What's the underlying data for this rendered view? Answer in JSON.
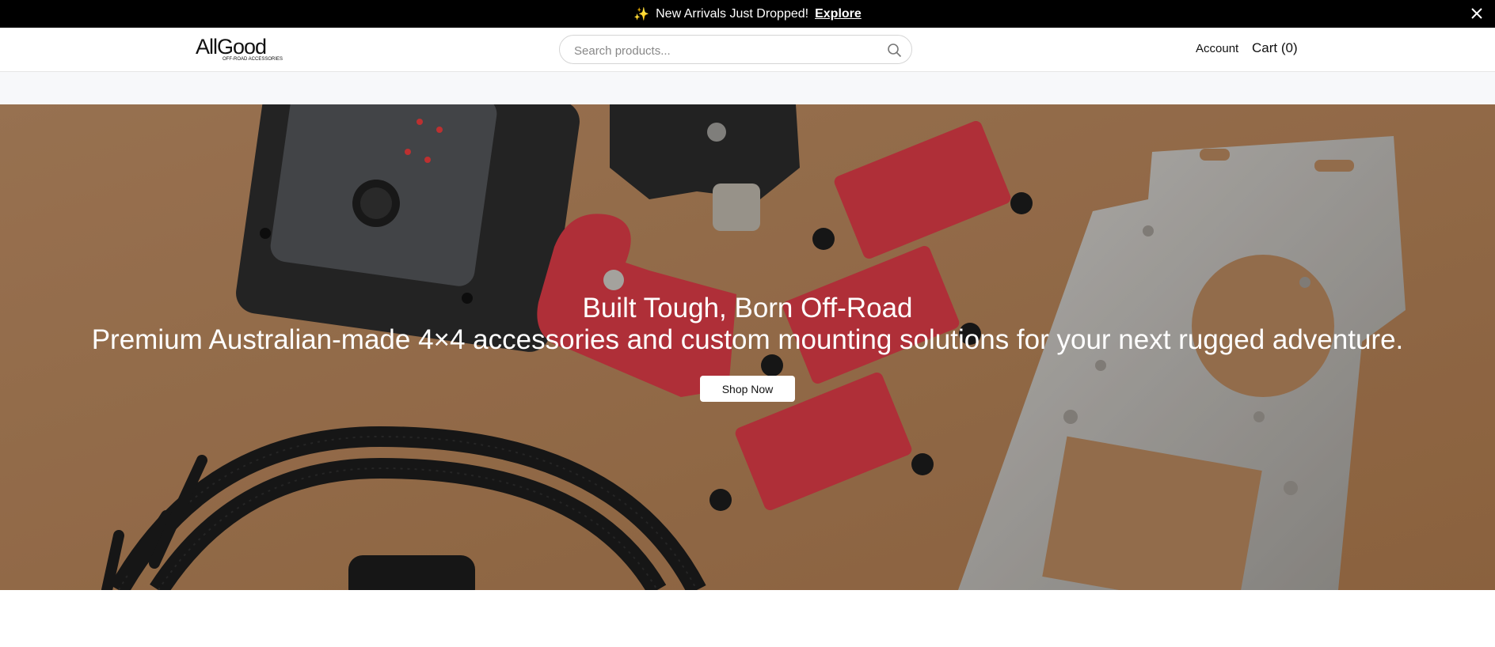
{
  "announcement": {
    "icon": "sparkles-icon",
    "glyph": "✨",
    "message": "New Arrivals Just Dropped!",
    "link_label": "Explore"
  },
  "header": {
    "logo_text": "AllGood",
    "logo_subtext": "OFF-ROAD ACCESSORIES",
    "search": {
      "placeholder": "Search products..."
    },
    "account_label": "Account",
    "cart_label": "Cart (0)"
  },
  "hero": {
    "title": "Built Tough, Born Off-Road",
    "subtitle": "Premium Australian-made 4×4 accessories and custom mounting solutions for your next rugged adventure.",
    "cta_label": "Shop Now"
  },
  "colors": {
    "announcement_bg": "#000000",
    "hero_bg": "#b5835a",
    "accent_red": "#d63a45"
  }
}
